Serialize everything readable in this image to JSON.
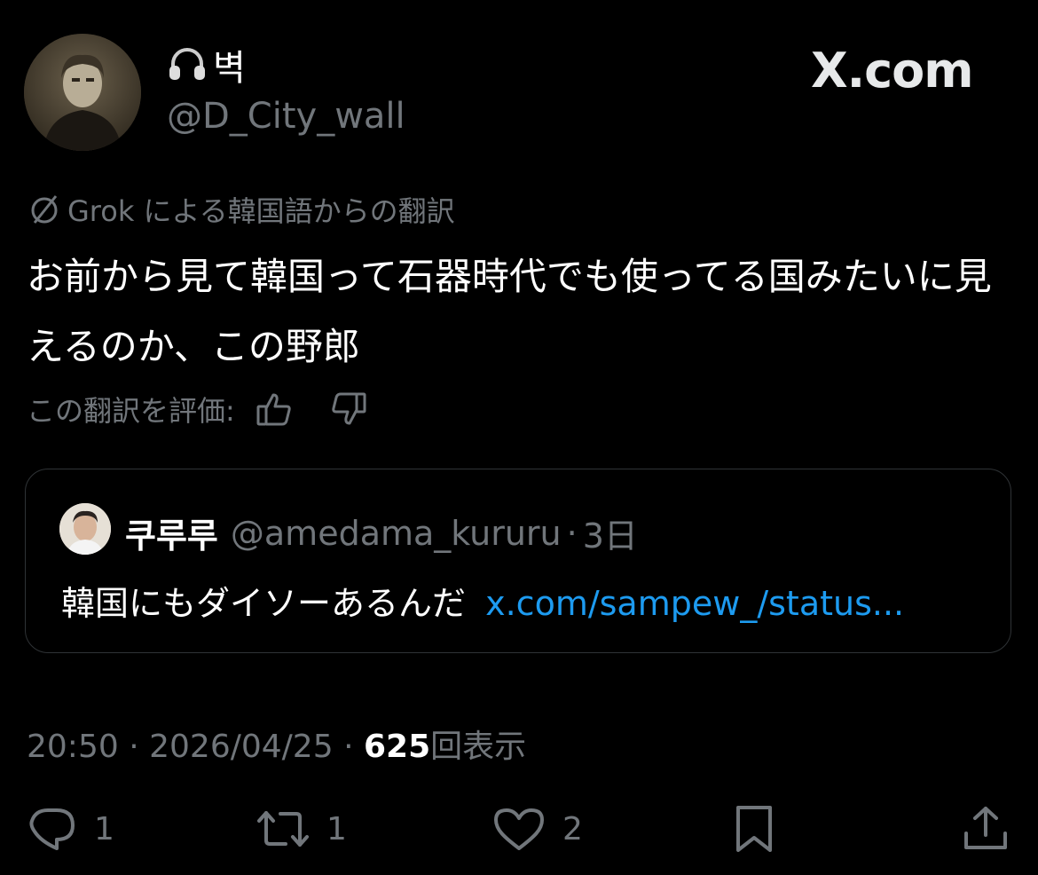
{
  "logo": "X.com",
  "author": {
    "display_name": "벽",
    "handle": "@D_City_wall",
    "icon": "headphones-icon"
  },
  "translation": {
    "note": "Grok による韓国語からの翻訳",
    "icon": "grok-slash-icon"
  },
  "tweet": {
    "text": "お前から見て韓国って石器時代でも使ってる国みたいに見えるのか、この野郎"
  },
  "rating": {
    "label": "この翻訳を評価:"
  },
  "quoted": {
    "name": "쿠루루",
    "handle": "@amedama_kururu",
    "separator": "·",
    "time": "3日",
    "text": "韓国にもダイソーあるんだ",
    "link": "x.com/sampew_/status..."
  },
  "meta": {
    "time": "20:50",
    "date": "2026/04/25",
    "sep": "·",
    "views": "625",
    "views_label": "回表示"
  },
  "actions": {
    "replies": "1",
    "reposts": "1",
    "likes": "2"
  },
  "colors": {
    "background": "#000000",
    "text": "#e7e9ea",
    "muted": "#71767b",
    "link": "#1d9bf0",
    "border": "#2f3336"
  }
}
